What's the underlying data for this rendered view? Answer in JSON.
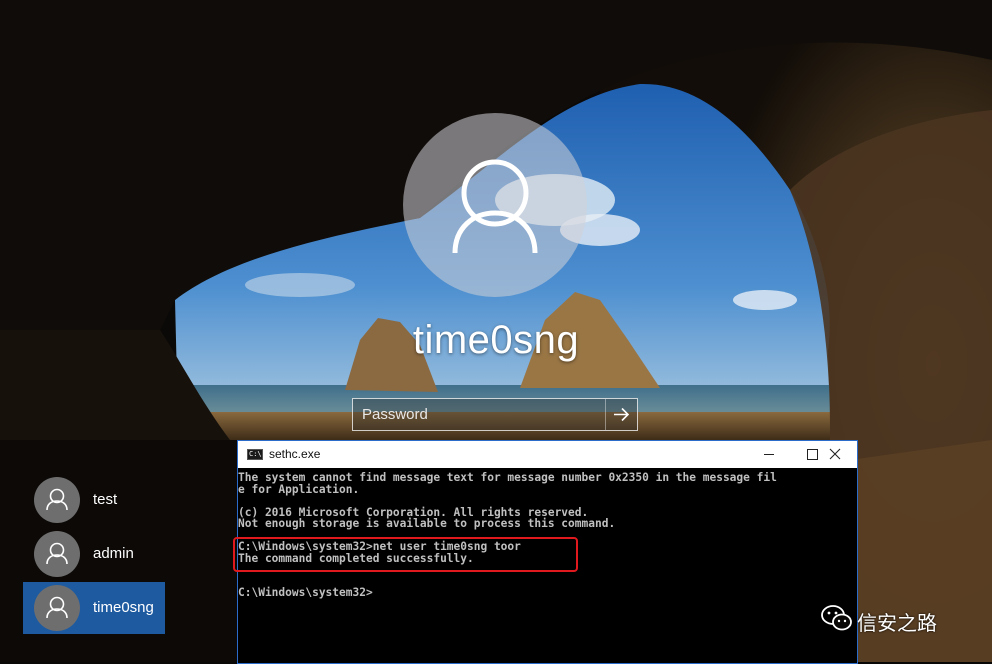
{
  "login": {
    "username": "time0sng",
    "password_placeholder": "Password",
    "avatar_icon": "user-icon",
    "submit_icon": "arrow-right-icon"
  },
  "users": [
    {
      "label": "test",
      "selected": false
    },
    {
      "label": "admin",
      "selected": false
    },
    {
      "label": "time0sng",
      "selected": true
    }
  ],
  "cmd_window": {
    "title": "sethc.exe",
    "icon": "console-icon",
    "icon_text": "C:\\",
    "controls": [
      "minimize-icon",
      "maximize-icon",
      "close-icon"
    ],
    "lines": [
      "The system cannot find message text for message number 0x2350 in the message fil",
      "e for Application.",
      "",
      "(c) 2016 Microsoft Corporation. All rights reserved.",
      "Not enough storage is available to process this command.",
      "",
      "C:\\Windows\\system32>net user time0sng toor",
      "The command completed successfully.",
      "",
      "C:\\Windows\\system32>"
    ]
  },
  "watermark": {
    "text": "信安之路",
    "icon": "wechat-icon"
  },
  "colors": {
    "selected_tile": "#1e5aa0",
    "highlight_box": "#e0191e",
    "cmd_border": "#2b6bc9"
  }
}
